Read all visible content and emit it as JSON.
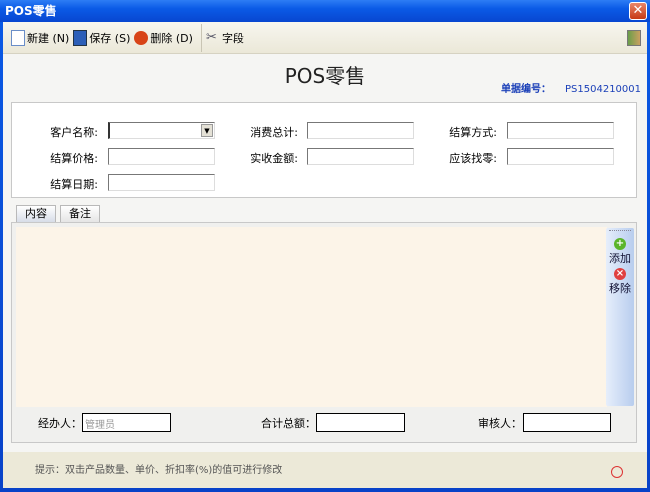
{
  "window": {
    "title": "POS零售",
    "close": "✕"
  },
  "toolbar": {
    "new": "新建 (N)",
    "save": "保存 (S)",
    "delete": "删除 (D)",
    "fields": "字段"
  },
  "header": {
    "title": "POS零售",
    "bill_label": "单据编号：",
    "bill_no": "PS1504210001"
  },
  "form": {
    "customer_label": "客户名称:",
    "customer_value": "",
    "total_label": "消费总计:",
    "payment_method_label": "结算方式:",
    "price_label": "结算价格:",
    "received_label": "实收金额:",
    "change_label": "应该找零:",
    "date_label": "结算日期:"
  },
  "tabs": [
    "内容",
    "备注"
  ],
  "side": {
    "add": "添加",
    "remove": "移除"
  },
  "footer": {
    "handler_label": "经办人：",
    "handler_value": "管理员",
    "sum_label": "合计总额：",
    "reviewer_label": "审核人："
  },
  "status": {
    "hint": "提示：双击产品数量、单价、折扣率(%)的值可进行修改"
  }
}
